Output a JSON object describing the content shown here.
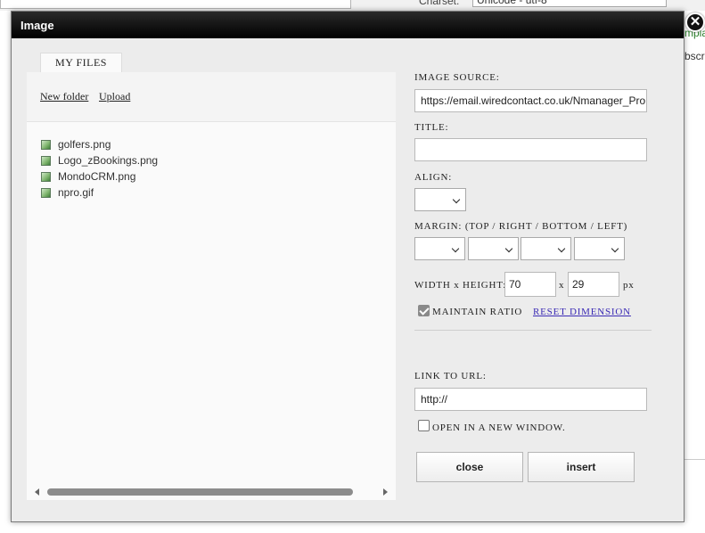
{
  "background": {
    "charset_label": "Charset:",
    "charset_value": "Unicode - utf-8",
    "side_text_1": "mpla",
    "side_text_2": "bscri"
  },
  "dialog": {
    "title": "Image",
    "close_glyph": "✕"
  },
  "file_browser": {
    "tab_label": "MY FILES",
    "new_folder_label": "New folder",
    "upload_label": "Upload",
    "files": [
      {
        "name": "golfers.png"
      },
      {
        "name": "Logo_zBookings.png"
      },
      {
        "name": "MondoCRM.png"
      },
      {
        "name": "npro.gif"
      }
    ]
  },
  "properties": {
    "image_source_label": "IMAGE SOURCE:",
    "image_source_value": "https://email.wiredcontact.co.uk/Nmanager_Pro",
    "title_label": "TITLE:",
    "title_value": "",
    "align_label": "ALIGN:",
    "margin_label": "MARGIN: (TOP / RIGHT / BOTTOM / LEFT)",
    "size_label": "WIDTH x HEIGHT:",
    "width_value": "70",
    "times_label": "x",
    "height_value": "29",
    "unit_label": "px",
    "maintain_ratio_label": "MAINTAIN RATIO",
    "maintain_ratio_checked": true,
    "reset_dimension_label": "RESET DIMENSION",
    "link_label": "LINK TO URL:",
    "link_value": "http://",
    "new_window_label": "OPEN IN A NEW WINDOW.",
    "new_window_checked": false
  },
  "buttons": {
    "close_label": "close",
    "insert_label": "insert"
  }
}
